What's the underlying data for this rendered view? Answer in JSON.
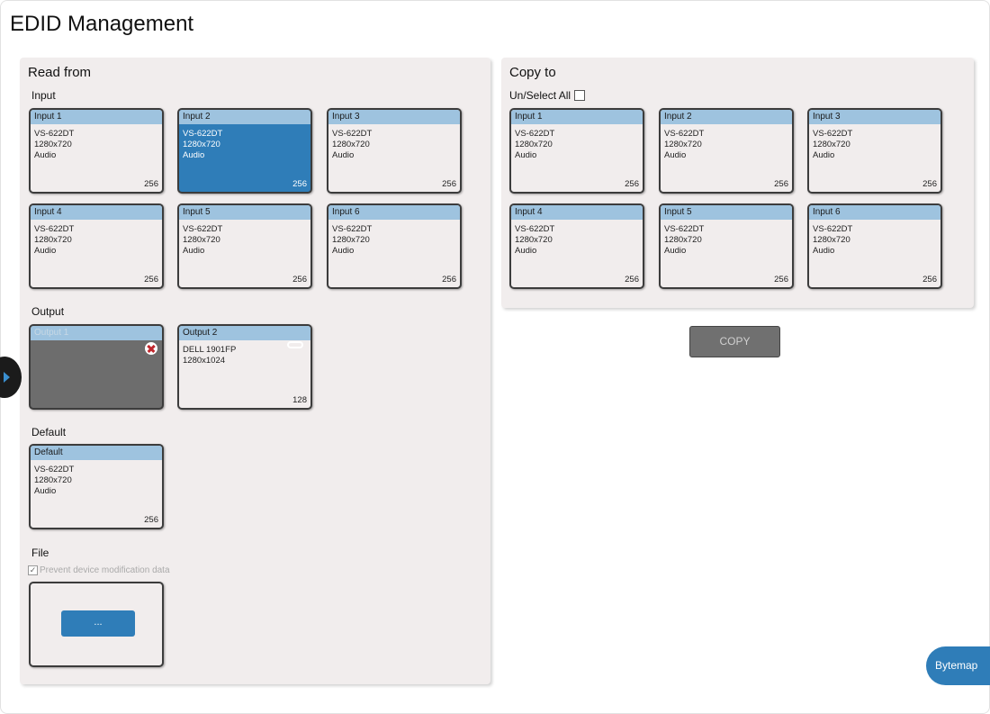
{
  "page": {
    "title": "EDID Management"
  },
  "read_from": {
    "title": "Read from",
    "input_label": "Input",
    "inputs": [
      {
        "name": "Input 1",
        "device": "VS-622DT",
        "resolution": "1280x720",
        "audio": "Audio",
        "size": "256"
      },
      {
        "name": "Input 2",
        "device": "VS-622DT",
        "resolution": "1280x720",
        "audio": "Audio",
        "size": "256",
        "selected": true
      },
      {
        "name": "Input 3",
        "device": "VS-622DT",
        "resolution": "1280x720",
        "audio": "Audio",
        "size": "256"
      },
      {
        "name": "Input 4",
        "device": "VS-622DT",
        "resolution": "1280x720",
        "audio": "Audio",
        "size": "256"
      },
      {
        "name": "Input 5",
        "device": "VS-622DT",
        "resolution": "1280x720",
        "audio": "Audio",
        "size": "256"
      },
      {
        "name": "Input 6",
        "device": "VS-622DT",
        "resolution": "1280x720",
        "audio": "Audio",
        "size": "256"
      }
    ],
    "output_label": "Output",
    "outputs": [
      {
        "name": "Output 1",
        "status": "disconnected",
        "icon": "disconnected-x-icon"
      },
      {
        "name": "Output 2",
        "device": "DELL 1901FP",
        "resolution": "1280x1024",
        "size": "128",
        "icon": "connected-link-icon"
      }
    ],
    "default_label": "Default",
    "default": {
      "name": "Default",
      "device": "VS-622DT",
      "resolution": "1280x720",
      "audio": "Audio",
      "size": "256"
    },
    "file_label": "File",
    "prevent_label": "Prevent device modification data",
    "prevent_checked": true,
    "browse_label": "..."
  },
  "copy_to": {
    "title": "Copy to",
    "unselect_label": "Un/Select All",
    "unselect_checked": false,
    "outputs": [
      {
        "name": "Input 1",
        "device": "VS-622DT",
        "resolution": "1280x720",
        "audio": "Audio",
        "size": "256"
      },
      {
        "name": "Input 2",
        "device": "VS-622DT",
        "resolution": "1280x720",
        "audio": "Audio",
        "size": "256"
      },
      {
        "name": "Input 3",
        "device": "VS-622DT",
        "resolution": "1280x720",
        "audio": "Audio",
        "size": "256"
      },
      {
        "name": "Input 4",
        "device": "VS-622DT",
        "resolution": "1280x720",
        "audio": "Audio",
        "size": "256"
      },
      {
        "name": "Input 5",
        "device": "VS-622DT",
        "resolution": "1280x720",
        "audio": "Audio",
        "size": "256"
      },
      {
        "name": "Input 6",
        "device": "VS-622DT",
        "resolution": "1280x720",
        "audio": "Audio",
        "size": "256"
      }
    ],
    "copy_label": "COPY"
  },
  "bytemap_label": "Bytemap",
  "colors": {
    "accent": "#2f7db8",
    "card_header": "#9ec3df",
    "panel_bg": "#f1eded",
    "disconnected_bg": "#6d6d6d",
    "copy_button_bg": "#707070"
  }
}
